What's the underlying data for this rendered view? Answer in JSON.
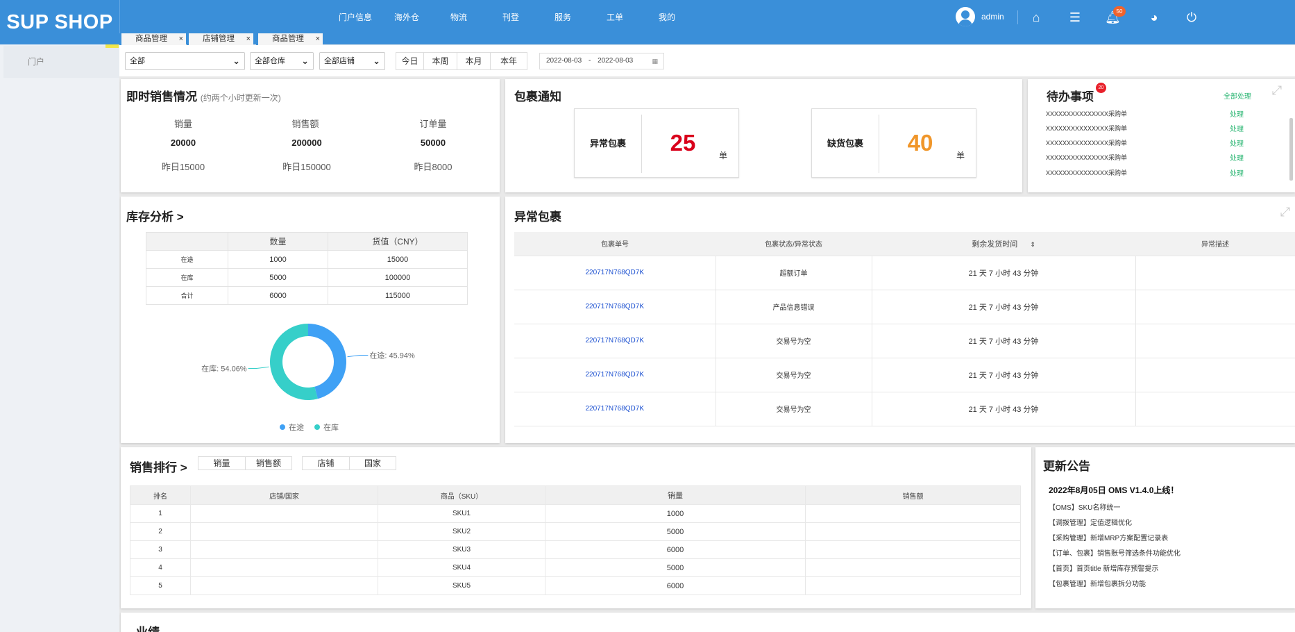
{
  "app": {
    "logo": "SUP SHOP",
    "user": "admin",
    "notif_count": "50"
  },
  "nav": [
    "门户信息",
    "海外仓",
    "物流",
    "刊登",
    "服务",
    "工单",
    "我的"
  ],
  "tabs": [
    "商品管理",
    "店铺管理",
    "商品管理"
  ],
  "sidebar": {
    "item": "门户"
  },
  "filters": {
    "f1": "全部",
    "f2": "全部仓库",
    "f3": "全部店铺",
    "periods": [
      "今日",
      "本周",
      "本月",
      "本年"
    ],
    "date_start": "2022-08-03",
    "date_sep": "-",
    "date_end": "2022-08-03"
  },
  "sales": {
    "title": "即时销售情况",
    "subtitle": "(约两个小时更新一次)",
    "cols": [
      {
        "label": "销量",
        "value": "20000",
        "yesterday": "昨日15000"
      },
      {
        "label": "销售额",
        "value": "200000",
        "yesterday": "昨日150000"
      },
      {
        "label": "订单量",
        "value": "50000",
        "yesterday": "昨日8000"
      }
    ]
  },
  "package": {
    "title": "包裹通知",
    "abnormal_label": "异常包裹",
    "abnormal_value": "25",
    "short_label": "缺货包裹",
    "short_value": "40",
    "unit": "单",
    "abnormal_color": "#d9001b",
    "short_color": "#f0962a"
  },
  "todo": {
    "title": "待办事项",
    "badge": "20",
    "handle_all": "全部处理",
    "rows": [
      {
        "text": "XXXXXXXXXXXXXXX采购单",
        "action": "处理"
      },
      {
        "text": "XXXXXXXXXXXXXXX采购单",
        "action": "处理"
      },
      {
        "text": "XXXXXXXXXXXXXXX采购单",
        "action": "处理"
      },
      {
        "text": "XXXXXXXXXXXXXXX采购单",
        "action": "处理"
      },
      {
        "text": "XXXXXXXXXXXXXXX采购单",
        "action": "处理"
      }
    ]
  },
  "inventory": {
    "title": "库存分析 >",
    "headers": [
      "",
      "数量",
      "货值（CNY）"
    ],
    "rows": [
      [
        "在途",
        "1000",
        "15000"
      ],
      [
        "在库",
        "5000",
        "100000"
      ],
      [
        "合计",
        "6000",
        "115000"
      ]
    ]
  },
  "chart_data": {
    "type": "pie",
    "categories": [
      "在途",
      "在库"
    ],
    "values": [
      45.94,
      54.06
    ],
    "labels": [
      "在途: 45.94%",
      "在库: 54.06%"
    ],
    "colors": [
      "#3fa1f5",
      "#36cfc9"
    ],
    "legend": [
      "在途",
      "在库"
    ],
    "legend_position": "bottom"
  },
  "abnormal": {
    "title": "异常包裹",
    "headers": [
      "包裹单号",
      "包裹状态/异常状态",
      "剩余发货时间",
      "异常描述"
    ],
    "rows": [
      [
        "220717N768QD7K",
        "超额订单",
        "21 天 7 小时 43 分钟",
        ""
      ],
      [
        "220717N768QD7K",
        "产品信息错误",
        "21 天 7 小时 43 分钟",
        ""
      ],
      [
        "220717N768QD7K",
        "交易号为空",
        "21 天 7 小时 43 分钟",
        ""
      ],
      [
        "220717N768QD7K",
        "交易号为空",
        "21 天 7 小时 43 分钟",
        ""
      ],
      [
        "220717N768QD7K",
        "交易号为空",
        "21 天 7 小时 43 分钟",
        ""
      ]
    ]
  },
  "ranking": {
    "title": "销售排行 >",
    "tabs1": [
      "销量",
      "销售额"
    ],
    "tabs2": [
      "店铺",
      "国家"
    ],
    "headers": [
      "排名",
      "店铺/国家",
      "商品（SKU）",
      "销量",
      "销售额"
    ],
    "rows": [
      [
        "1",
        "",
        "SKU1",
        "1000",
        ""
      ],
      [
        "2",
        "",
        "SKU2",
        "5000",
        ""
      ],
      [
        "3",
        "",
        "SKU3",
        "6000",
        ""
      ],
      [
        "4",
        "",
        "SKU4",
        "5000",
        ""
      ],
      [
        "5",
        "",
        "SKU5",
        "6000",
        ""
      ]
    ]
  },
  "announce": {
    "title": "更新公告",
    "headline": "2022年8月05日 OMS V1.4.0上线！",
    "items": [
      "【OMS】SKU名称统一",
      "【调拨管理】定值逻辑优化",
      "【采购管理】新增MRP方案配置记录表",
      "【订单、包裹】销售账号筛选条件功能优化",
      "【首页】首页title 新增库存预警提示",
      "【包裹管理】新增包裹拆分功能"
    ]
  },
  "performance": {
    "title": "业绩"
  }
}
